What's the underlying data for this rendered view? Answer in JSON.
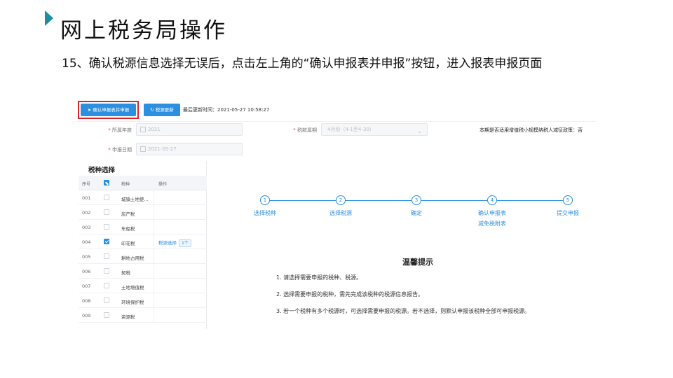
{
  "slide": {
    "title": "网上税务局操作",
    "instruction": "15、确认税源信息选择无误后，点击左上角的“确认申报表并申报”按钮，进入报表申报页面"
  },
  "toolbar": {
    "confirm_label": "确认申报表并申报",
    "update_label": "税源更新",
    "update_time": "最后更新时间：2021-05-27 10:58:27"
  },
  "form": {
    "year_label": "所属年度",
    "year_value": "2021",
    "period_label": "税款属期",
    "period_value": "4月份（4-1至4-30）",
    "date_label": "申报日期",
    "date_value": "2021-05-27",
    "policy_text": "本期是否适用增值税小规模纳税人减征政策：否"
  },
  "tax_table": {
    "title": "税种选择",
    "headers": [
      "序号",
      "税种",
      "操作"
    ],
    "rows": [
      {
        "no": "001",
        "name": "城镇土地使...",
        "checked": false,
        "op": "",
        "badge": ""
      },
      {
        "no": "002",
        "name": "房产税",
        "checked": false,
        "op": "",
        "badge": ""
      },
      {
        "no": "003",
        "name": "车船税",
        "checked": false,
        "op": "",
        "badge": ""
      },
      {
        "no": "004",
        "name": "印花税",
        "checked": true,
        "op": "税源选择",
        "badge": "1个"
      },
      {
        "no": "005",
        "name": "耕地占用税",
        "checked": false,
        "op": "",
        "badge": ""
      },
      {
        "no": "006",
        "name": "契税",
        "checked": false,
        "op": "",
        "badge": ""
      },
      {
        "no": "007",
        "name": "土地增值税",
        "checked": false,
        "op": "",
        "badge": ""
      },
      {
        "no": "008",
        "name": "环境保护税",
        "checked": false,
        "op": "",
        "badge": ""
      },
      {
        "no": "009",
        "name": "资源税",
        "checked": false,
        "op": "",
        "badge": ""
      }
    ]
  },
  "stepper": {
    "steps": [
      {
        "num": "1",
        "label": "选择税种"
      },
      {
        "num": "2",
        "label": "选择税源"
      },
      {
        "num": "3",
        "label": "确定"
      },
      {
        "num": "4",
        "label": "确认申报表\n减免税附表"
      },
      {
        "num": "5",
        "label": "提交申报"
      }
    ]
  },
  "tips": {
    "title": "温馨提示",
    "items": [
      "1. 请选择需要申报的税种、税源。",
      "2. 选择需要申报的税种，需先完成该税种的税源信息报告。",
      "3. 若一个税种有多个税源时，可选择需要申报的税源。若不选择，则默认申报该税种全部可申报税源。"
    ]
  },
  "colors": {
    "accent": "#2c8fdf",
    "highlight": "#d9262b",
    "title_arrow": "#1a8fa0"
  }
}
